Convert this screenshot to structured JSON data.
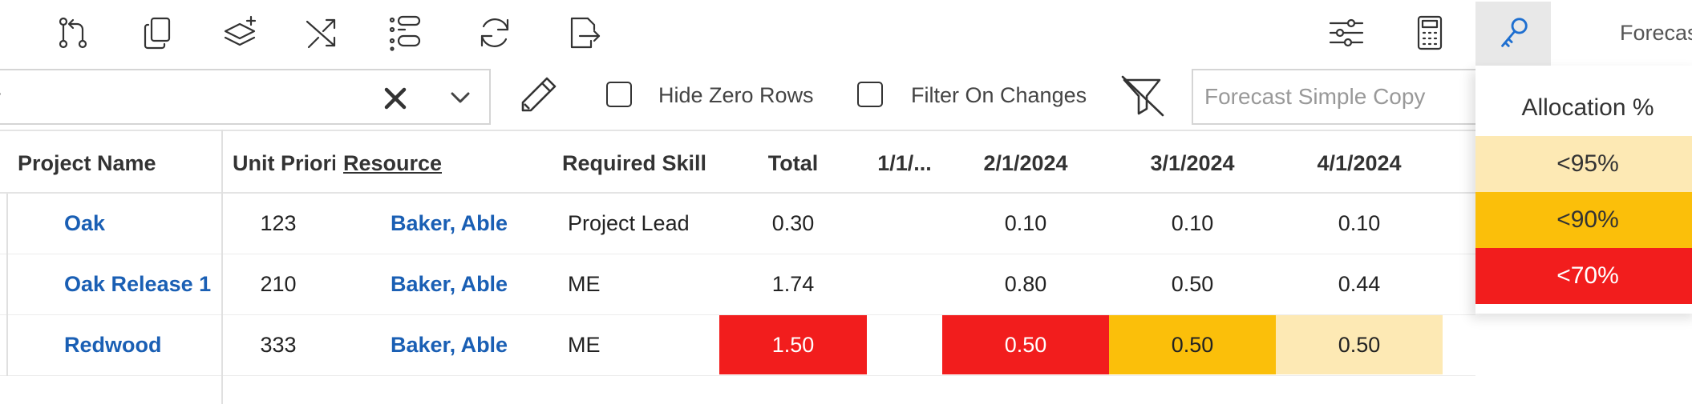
{
  "toolbar": {
    "icons": [
      "merge-icon",
      "copy-icon",
      "add-layer-icon",
      "shuffle-icon",
      "list-toggle-icon",
      "refresh-icon",
      "export-icon"
    ],
    "right_icons": [
      "sliders-icon",
      "calculator-icon",
      "key-icon"
    ],
    "tab_label": "Forecast"
  },
  "filter_bar": {
    "search_placeholder": "r",
    "hide_zero_rows_label": "Hide Zero Rows",
    "filter_on_changes_label": "Filter On Changes",
    "view_name_placeholder": "Forecast Simple Copy"
  },
  "grid": {
    "columns": [
      "Project Name",
      "Unit Priori",
      "Resource",
      "Required Skill",
      "Total",
      "1/1/...",
      "2/1/2024",
      "3/1/2024",
      "4/1/2024"
    ],
    "rows": [
      {
        "project": "Oak",
        "priority": "123",
        "resource": "Baker, Able",
        "skill": "Project Lead",
        "total": "0.30",
        "m1": "",
        "m2": "0.10",
        "m3": "0.10",
        "m4": "0.10"
      },
      {
        "project": "Oak Release 1",
        "priority": "210",
        "resource": "Baker, Able",
        "skill": "ME",
        "total": "1.74",
        "m1": "",
        "m2": "0.80",
        "m3": "0.50",
        "m4": "0.44"
      },
      {
        "project": "Redwood",
        "priority": "333",
        "resource": "Baker, Able",
        "skill": "ME",
        "total": "1.50",
        "m1": "",
        "m2": "0.50",
        "m3": "0.50",
        "m4": "0.50"
      }
    ]
  },
  "legend": {
    "title": "Allocation %",
    "items": [
      {
        "label": "<95%",
        "color": "#fde9b4"
      },
      {
        "label": "<90%",
        "color": "#fbbf0a"
      },
      {
        "label": "<70%",
        "color": "#f21d1d"
      }
    ]
  },
  "colors": {
    "link": "#1a5fb4",
    "red": "#f21d1d",
    "amber": "#fbbf0a",
    "pale": "#fde9b4"
  }
}
